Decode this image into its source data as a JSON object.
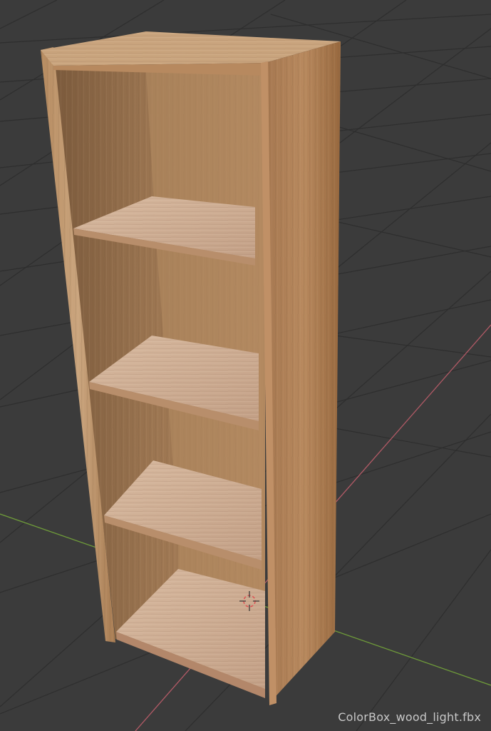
{
  "viewport": {
    "caption": "ColorBox_wood_light.fbx",
    "background_color": "#3b3b3b",
    "grid_color": "#2f2f2f",
    "x_axis_color": "#b25a66",
    "y_axis_color": "#6e9a3a"
  },
  "model": {
    "object": "bookshelf",
    "material": "light wood",
    "shelf_count": 4
  }
}
